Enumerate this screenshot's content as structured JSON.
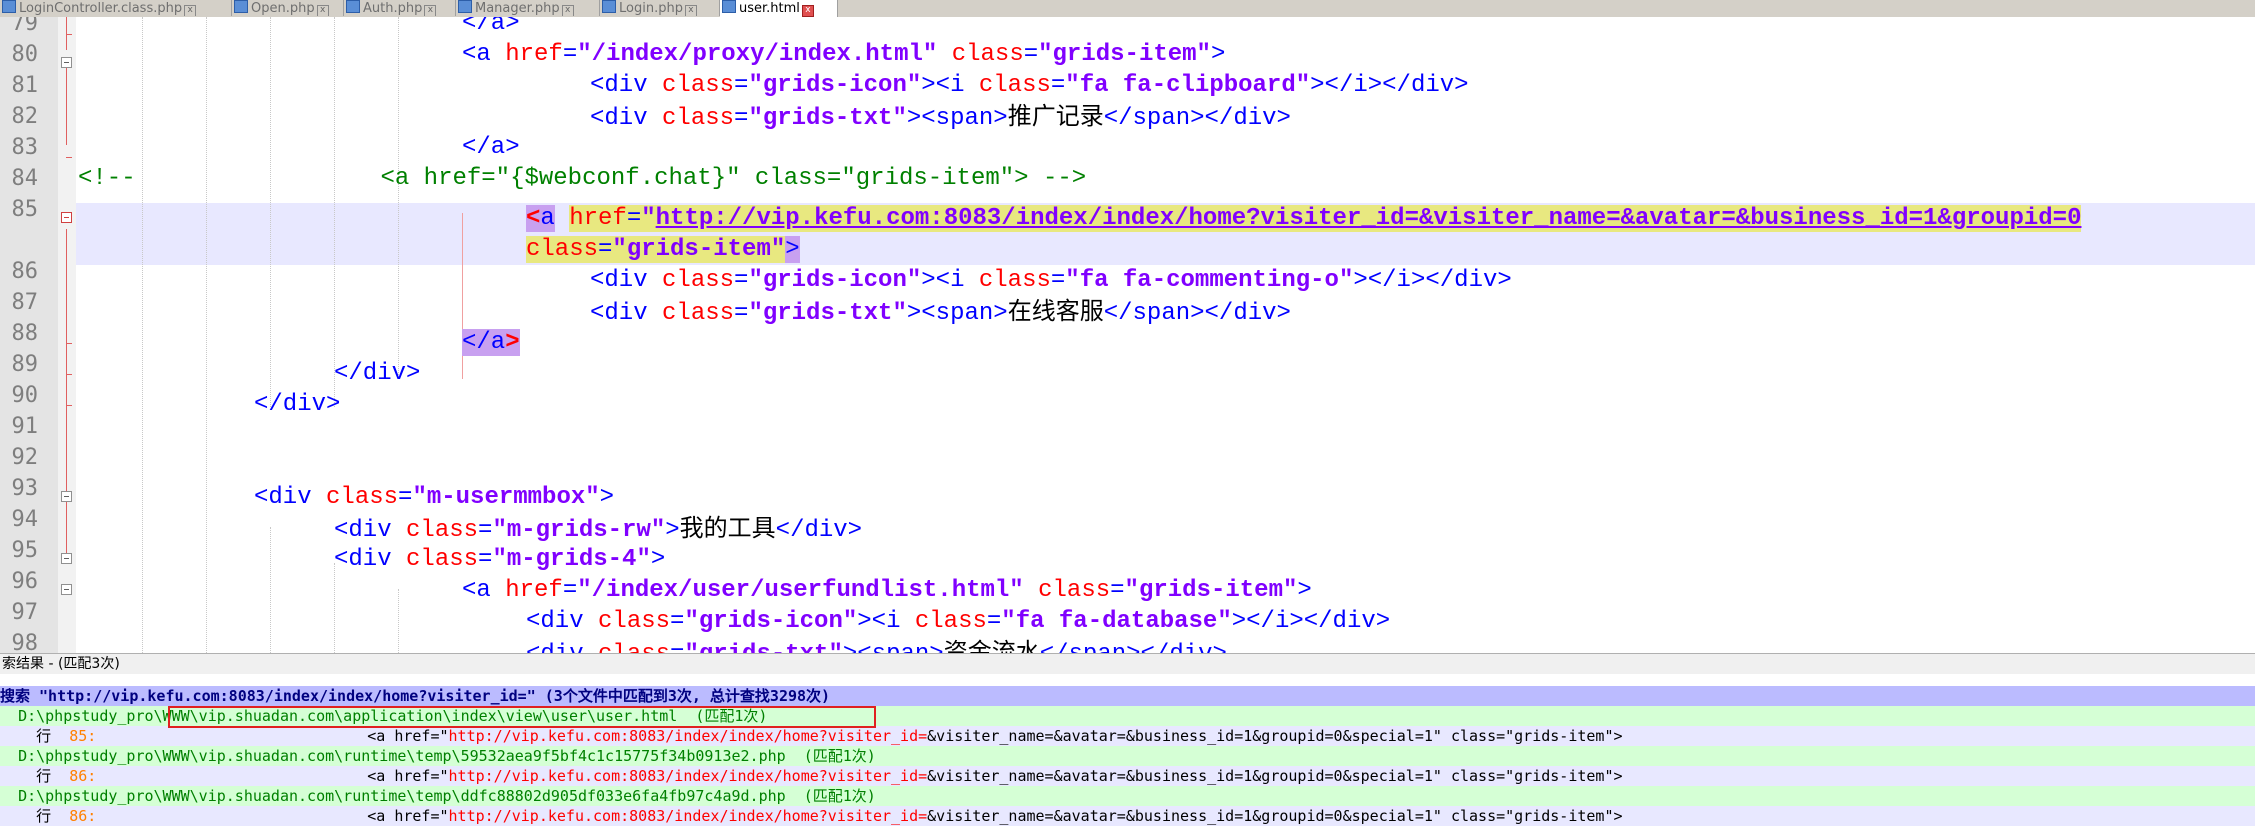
{
  "tabs": [
    {
      "label": "LoginController.class.php"
    },
    {
      "label": "Open.php"
    },
    {
      "label": "Auth.php"
    },
    {
      "label": "Manager.php"
    },
    {
      "label": "Login.php"
    },
    {
      "label": "user.html"
    }
  ],
  "active_tab": "user.html",
  "line_numbers": [
    "79",
    "80",
    "81",
    "82",
    "83",
    "84",
    "85",
    "86",
    "87",
    "88",
    "89",
    "90",
    "91",
    "92",
    "93",
    "94",
    "95",
    "96",
    "97",
    "98"
  ],
  "code": {
    "l79": {
      "close": "</a>"
    },
    "l80": {
      "open": "<a ",
      "attr1": "href",
      "eq1": "=",
      "val1": "\"/index/proxy/index.html\"",
      "attr2": "class",
      "eq2": "=",
      "val2": "\"grids-item\"",
      "end": ">"
    },
    "l81": {
      "a": "<div ",
      "attr1": "class",
      "eq": "=",
      "val1": "\"grids-icon\"",
      "b": "><i ",
      "attr2": "class",
      "val2": "\"fa fa-clipboard\"",
      "c": "></i></div>"
    },
    "l82": {
      "a": "<div ",
      "attr1": "class",
      "eq": "=",
      "val1": "\"grids-txt\"",
      "b": "><span>",
      "text": "推广记录",
      "c": "</span></div>"
    },
    "l83": {
      "close": "</a>"
    },
    "l84": {
      "comment_start": "<!--",
      "comment_body": "<a href=\"{$webconf.chat}\" class=\"grids-item\"> -->"
    },
    "l85": {
      "lt": "<",
      "a": "a",
      "attr1": "href",
      "eq": "=",
      "q": "\"",
      "url": "http://vip.kefu.com:8083/index/index/home?visiter_id=&visiter_name=&avatar=&business_id=1&groupid=0"
    },
    "l85b": {
      "attr": "class",
      "eq": "=",
      "val": "\"grids-item\"",
      "end": ">"
    },
    "l86": {
      "a": "<div ",
      "attr1": "class",
      "eq": "=",
      "val1": "\"grids-icon\"",
      "b": "><i ",
      "attr2": "class",
      "val2": "\"fa fa-commenting-o\"",
      "c": "></i></div>"
    },
    "l87": {
      "a": "<div ",
      "attr1": "class",
      "eq": "=",
      "val1": "\"grids-txt\"",
      "b": "><span>",
      "text": "在线客服",
      "c": "</span></div>"
    },
    "l88": {
      "open": "</a",
      "close": ">"
    },
    "l89": {
      "close": "</div>"
    },
    "l90": {
      "close": "</div>"
    },
    "l93": {
      "a": "<div ",
      "attr": "class",
      "eq": "=",
      "val": "\"m-usermmbox\"",
      "end": ">"
    },
    "l94": {
      "a": "<div ",
      "attr": "class",
      "eq": "=",
      "val": "\"m-grids-rw\"",
      "b": ">",
      "text": "我的工具",
      "c": "</div>"
    },
    "l95": {
      "a": "<div ",
      "attr": "class",
      "eq": "=",
      "val": "\"m-grids-4\"",
      "end": ">"
    },
    "l96": {
      "a": "<a ",
      "attr1": "href",
      "eq": "=",
      "val1": "\"/index/user/userfundlist.html\"",
      "attr2": "class",
      "val2": "\"grids-item\"",
      "end": ">"
    },
    "l97": {
      "a": "<div ",
      "attr1": "class",
      "eq": "=",
      "val1": "\"grids-icon\"",
      "b": "><i ",
      "attr2": "class",
      "val2": "\"fa fa-database\"",
      "c": "></i></div>"
    },
    "l98": {
      "a": "<div ",
      "attr1": "class",
      "eq": "=",
      "val1": "\"grids-txt\"",
      "b": "><span>",
      "text": "资金流水",
      "c": "</span></div>"
    }
  },
  "results": {
    "title": "索结果 - (匹配3次)",
    "search_line": "搜索 \"http://vip.kefu.com:8083/index/index/home?visiter_id=\" (3个文件中匹配到3次, 总计查找3298次)",
    "files": [
      {
        "path": "D:\\phpstudy_pro\\WWW\\vip.shuadan.com\\application\\index\\view\\user\\user.html",
        "count": "(匹配1次)",
        "line_label": "行",
        "line_no": "85:",
        "pre": "<a href=\"",
        "match": "http://vip.kefu.com:8083/index/index/home?visiter_id=",
        "post": "&visiter_name=&avatar=&business_id=1&groupid=0&special=1\" class=\"grids-item\">"
      },
      {
        "path": "D:\\phpstudy_pro\\WWW\\vip.shuadan.com\\runtime\\temp\\59532aea9f5bf4c1c15775f34b0913e2.php",
        "count": "(匹配1次)",
        "line_label": "行",
        "line_no": "86:",
        "pre": "<a href=\"",
        "match": "http://vip.kefu.com:8083/index/index/home?visiter_id=",
        "post": "&visiter_name=&avatar=&business_id=1&groupid=0&special=1\" class=\"grids-item\">"
      },
      {
        "path": "D:\\phpstudy_pro\\WWW\\vip.shuadan.com\\runtime\\temp\\ddfc88802d905df033e6fa4fb97c4a9d.php",
        "count": "(匹配1次)",
        "line_label": "行",
        "line_no": "86:",
        "pre": "<a href=\"",
        "match": "http://vip.kefu.com:8083/index/index/home?visiter_id=",
        "post": "&visiter_name=&avatar=&business_id=1&groupid=0&special=1\" class=\"grids-item\">"
      }
    ]
  }
}
